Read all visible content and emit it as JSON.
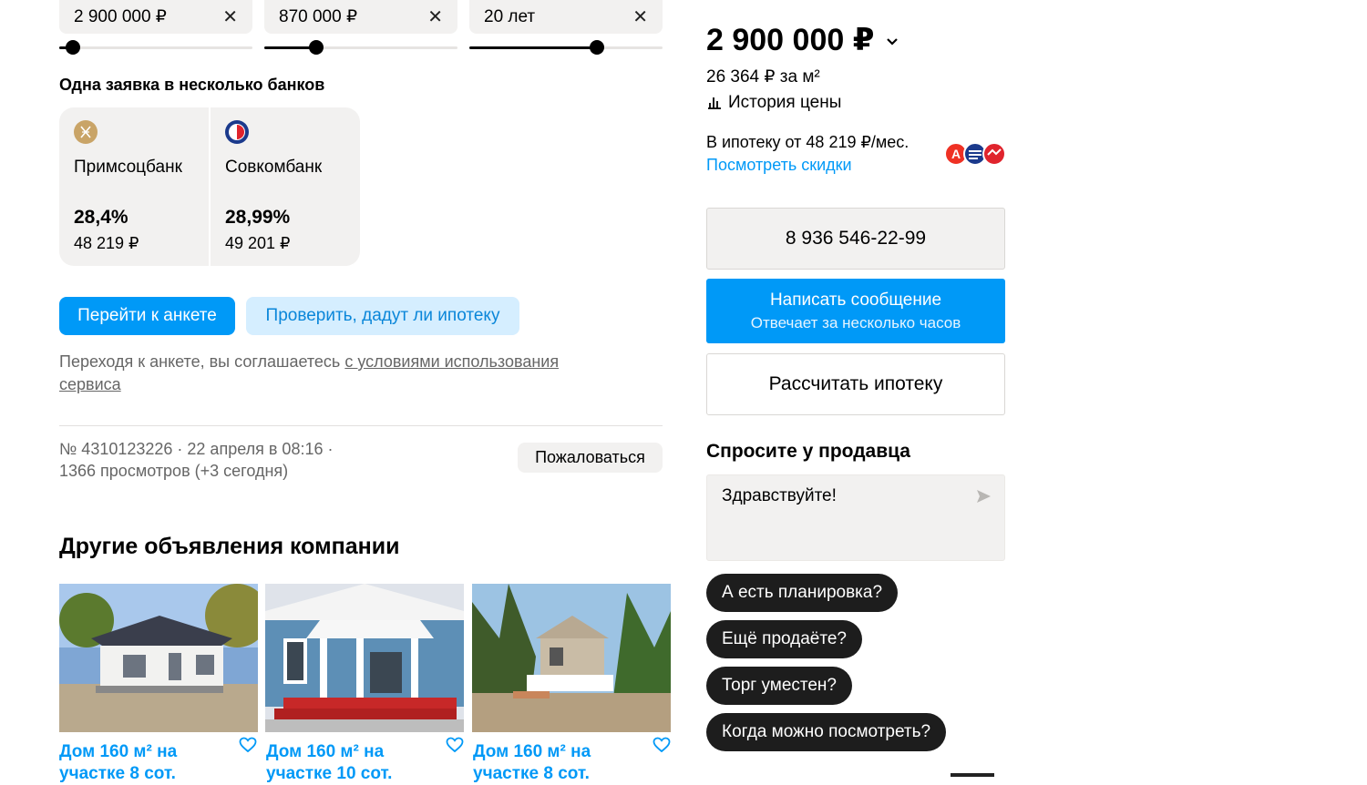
{
  "filters": {
    "price": {
      "value": "2 900 000 ₽",
      "fraction": 0.07
    },
    "down_payment": {
      "value": "870 000 ₽",
      "fraction": 0.27
    },
    "term": {
      "value": "20 лет",
      "fraction": 0.66
    },
    "clear_icon": "close-icon"
  },
  "banks": {
    "heading": "Одна заявка в несколько банков",
    "items": [
      {
        "name": "Примсоцбанк",
        "rate": "28,4%",
        "payment": "48 219 ₽",
        "logo": "primsoc-logo",
        "color": "#c9a467"
      },
      {
        "name": "Совкомбанк",
        "rate": "28,99%",
        "payment": "49 201 ₽",
        "logo": "sovcom-logo",
        "color": "#1b3a8c"
      }
    ],
    "go_button": "Перейти к анкете",
    "check_button": "Проверить, дадут ли ипотеку",
    "disclaimer_text": "Переходя к анкете, вы соглашаетесь ",
    "disclaimer_link": "с условиями использования сервиса"
  },
  "listing_meta": {
    "line1": "№ 4310123226 · 22 апреля в 08:16 ·",
    "line2": "1366 просмотров (+3 сегодня)",
    "report_button": "Пожаловаться"
  },
  "other_listings": {
    "heading": "Другие объявления компании",
    "items": [
      {
        "title_line1": "Дом 160 м² на",
        "title_line2": "участке 8 сот."
      },
      {
        "title_line1": "Дом 160 м² на",
        "title_line2": "участке 10 сот."
      },
      {
        "title_line1": "Дом 160 м² на",
        "title_line2": "участке 8 сот."
      }
    ]
  },
  "price_panel": {
    "price": "2 900 000 ₽",
    "per_m2": "26 364 ₽ за м²",
    "history_link": "История цены",
    "mortgage_text": "В ипотеку от 48 219 ₽/мес.",
    "discounts_link": "Посмотреть скидки",
    "phone": "8 936 546-22-99",
    "message_button": "Написать сообщение",
    "message_sub": "Отвечает за несколько часов",
    "calc_button": "Рассчитать ипотеку"
  },
  "ask_seller": {
    "heading": "Спросите у продавца",
    "message_value": "Здравствуйте!",
    "quick_questions": [
      "А есть планировка?",
      "Ещё продаёте?",
      "Торг уместен?",
      "Когда можно посмотреть?"
    ]
  },
  "colors": {
    "accent_blue": "#0099f7",
    "light_blue": "#d5eeff",
    "chip_dark": "#1d1d1d",
    "surface": "#f2f1f0"
  }
}
